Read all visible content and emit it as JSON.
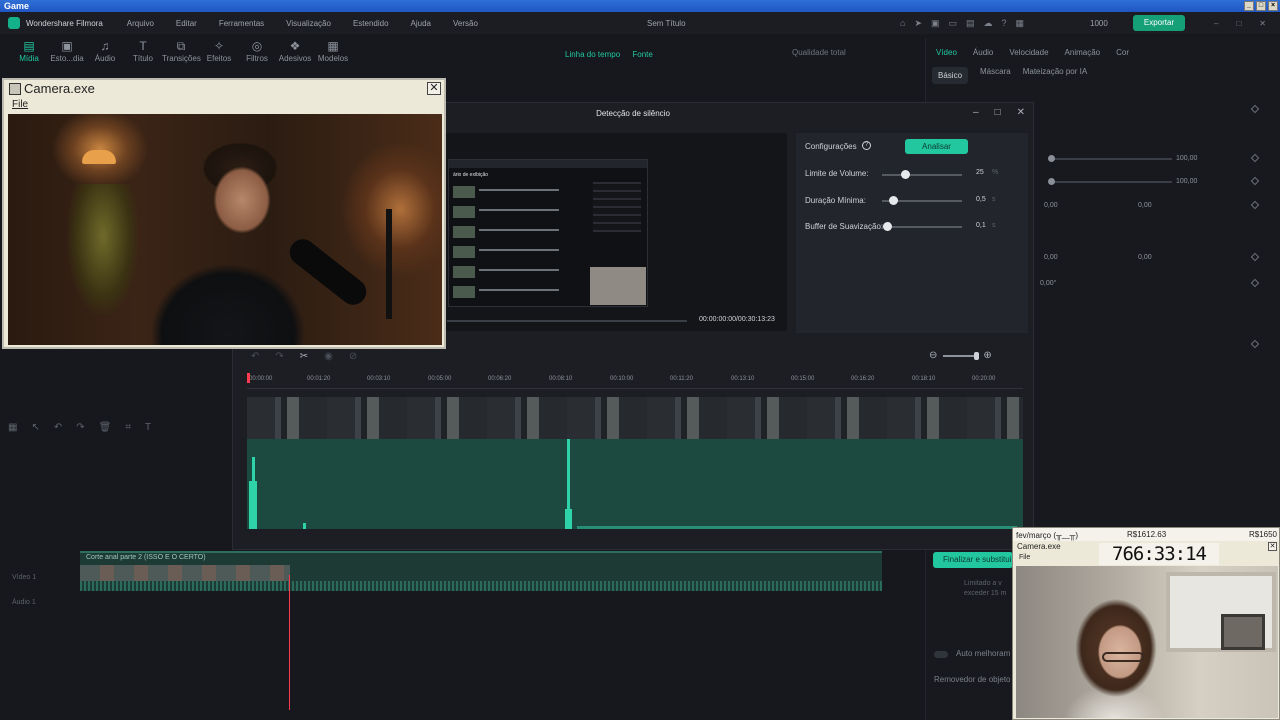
{
  "os": {
    "title": "Game"
  },
  "app": {
    "name": "Wondershare Filmora",
    "menus": [
      "Arquivo",
      "Editar",
      "Ferramentas",
      "Visualização",
      "Estendido",
      "Ajuda",
      "Versão"
    ],
    "project_name": "Sem Título",
    "credits": "1000",
    "export_label": "Exportar"
  },
  "ribbon": [
    {
      "label": "Mídia",
      "icon": "media-icon",
      "active": true
    },
    {
      "label": "Esto...dia",
      "icon": "stock-icon"
    },
    {
      "label": "Áudio",
      "icon": "audio-icon"
    },
    {
      "label": "Título",
      "icon": "title-icon"
    },
    {
      "label": "Transições",
      "icon": "transitions-icon"
    },
    {
      "label": "Efeitos",
      "icon": "effects-icon"
    },
    {
      "label": "Filtros",
      "icon": "filters-icon"
    },
    {
      "label": "Adesivos",
      "icon": "stickers-icon"
    },
    {
      "label": "Modelos",
      "icon": "templates-icon"
    }
  ],
  "preview_header": {
    "tab1": "Linha do tempo",
    "tab2": "Fonte",
    "quality": "Qualidade total"
  },
  "right_panel": {
    "tabs": [
      "Vídeo",
      "Áudio",
      "Velocidade",
      "Animação",
      "Cor"
    ],
    "subtabs": [
      "Básico",
      "Máscara",
      "Mateização por IA"
    ],
    "values": [
      "100,00",
      "100,00",
      "0,00",
      "0,00",
      "0,00",
      "0,00",
      "0,00°"
    ],
    "auto_enhance": "Auto melhoram",
    "object_remover": "Removedor de objeto",
    "limit_note_1": "Limitado a v",
    "limit_note_2": "exceder 15 m"
  },
  "timeline": {
    "clip_name": "Corte anal parte 2 (ISSO E O CERTO)",
    "video_label": "Vídeo 1",
    "audio_label": "Áudio 1"
  },
  "dialog": {
    "title": "Detecção de silêncio",
    "settings_label": "Configurações",
    "analyze_button": "Analisar",
    "params": [
      {
        "label": "Limite de Volume:",
        "value": "25",
        "unit": "%"
      },
      {
        "label": "Duração Mínima:",
        "value": "0,5",
        "unit": "s"
      },
      {
        "label": "Buffer de Suavização:",
        "value": "0,1",
        "unit": "s"
      }
    ],
    "time_display": "00:00:00:00/00:30:13:23",
    "ruler": [
      "00:00:00",
      "00:01:20",
      "00:03:10",
      "00:05:00",
      "00:06:20",
      "00:08:10",
      "00:10:00",
      "00:11:20",
      "00:13:10",
      "00:15:00",
      "00:16:20",
      "00:18:10",
      "00:20:00"
    ],
    "finalize_button": "Finalizar e substituir",
    "preview_title": "ário de exibição"
  },
  "camera_window": {
    "title": "Camera.exe",
    "menu": "File"
  },
  "stream_overlay": {
    "month": "fev/março (╥﹏╥)",
    "amount1": "R$1612.63",
    "amount2": "R$1650",
    "cam_title": "Camera.exe",
    "file_menu": "File",
    "timer": "766:33:14"
  }
}
